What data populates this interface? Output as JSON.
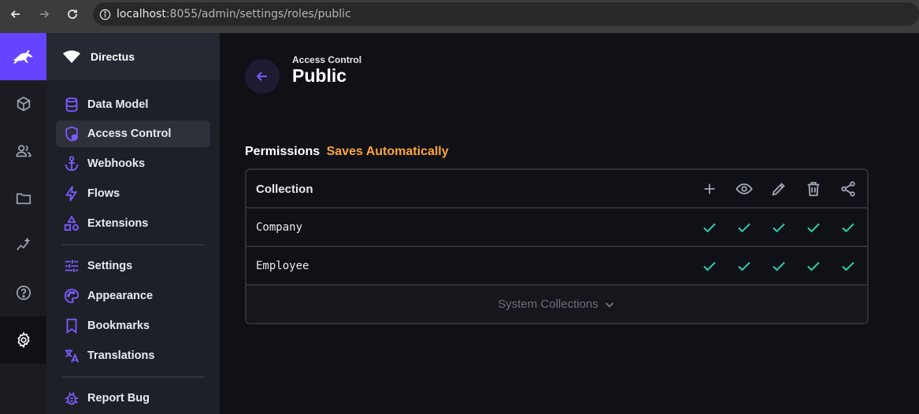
{
  "browser": {
    "url_host": "localhost",
    "url_path": ":8055/admin/settings/roles/public"
  },
  "project": {
    "name": "Directus"
  },
  "module_bar": {
    "items": [
      "content-icon",
      "users-icon",
      "files-icon",
      "insights-icon",
      "help-icon",
      "settings-icon"
    ]
  },
  "nav": {
    "items": [
      {
        "label": "Data Model",
        "icon": "database-icon"
      },
      {
        "label": "Access Control",
        "icon": "shield-icon"
      },
      {
        "label": "Webhooks",
        "icon": "anchor-icon"
      },
      {
        "label": "Flows",
        "icon": "bolt-icon"
      },
      {
        "label": "Extensions",
        "icon": "extensions-icon"
      },
      {
        "label": "Settings",
        "icon": "sliders-icon"
      },
      {
        "label": "Appearance",
        "icon": "palette-icon"
      },
      {
        "label": "Bookmarks",
        "icon": "bookmark-icon"
      },
      {
        "label": "Translations",
        "icon": "translate-icon"
      },
      {
        "label": "Report Bug",
        "icon": "bug-icon"
      }
    ]
  },
  "header": {
    "breadcrumb": "Access Control",
    "title": "Public"
  },
  "permissions": {
    "title": "Permissions",
    "note": "Saves Automatically",
    "column_header": "Collection",
    "columns": [
      "create",
      "read",
      "update",
      "delete",
      "share"
    ],
    "rows": [
      {
        "name": "Company",
        "create": true,
        "read": true,
        "update": true,
        "delete": true,
        "share": true
      },
      {
        "name": "Employee",
        "create": true,
        "read": true,
        "update": true,
        "delete": true,
        "share": true
      }
    ],
    "system_collections_label": "System Collections"
  },
  "colors": {
    "accent": "#6644ff",
    "warning": "#ffa439",
    "success": "#2ecda7"
  }
}
